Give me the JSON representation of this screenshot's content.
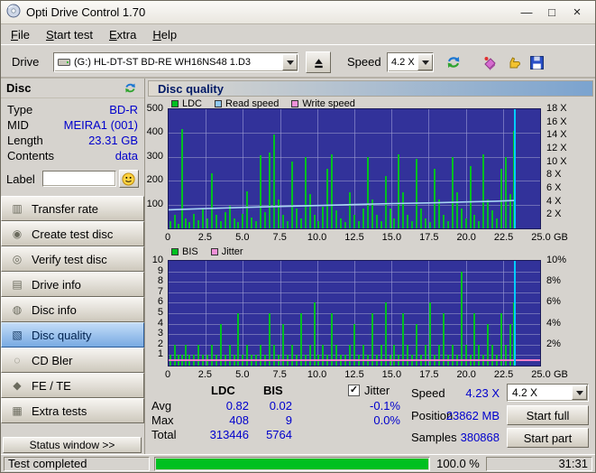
{
  "window": {
    "title": "Opti Drive Control 1.70",
    "controls": [
      {
        "name": "minimize",
        "glyph": "—"
      },
      {
        "name": "maximize",
        "glyph": "□"
      },
      {
        "name": "close",
        "glyph": "×"
      }
    ]
  },
  "menu": {
    "items": [
      "File",
      "Start test",
      "Extra",
      "Help"
    ]
  },
  "toolbar": {
    "drive_label": "Drive",
    "drive_value": "(G:)  HL-DT-ST BD-RE  WH16NS48 1.D3",
    "speed_label": "Speed",
    "speed_value": "4.2 X"
  },
  "sidebar": {
    "header": "Disc",
    "info": [
      {
        "label": "Type",
        "value": "BD-R"
      },
      {
        "label": "MID",
        "value": "MEIRA1 (001)"
      },
      {
        "label": "Length",
        "value": "23.31 GB"
      },
      {
        "label": "Contents",
        "value": "data"
      }
    ],
    "label_caption": "Label",
    "label_value": "",
    "buttons": [
      {
        "label": "Transfer rate",
        "glyph": "▥"
      },
      {
        "label": "Create test disc",
        "glyph": "◉"
      },
      {
        "label": "Verify test disc",
        "glyph": "◎"
      },
      {
        "label": "Drive info",
        "glyph": "▤"
      },
      {
        "label": "Disc info",
        "glyph": "◍"
      },
      {
        "label": "Disc quality",
        "glyph": "▧"
      },
      {
        "label": "CD Bler",
        "glyph": "◌"
      },
      {
        "label": "FE / TE",
        "glyph": "◆"
      },
      {
        "label": "Extra tests",
        "glyph": "▦"
      }
    ],
    "active_button": "Disc quality",
    "status_window_label": "Status window >>"
  },
  "main": {
    "panel_title": "Disc quality",
    "legend1": [
      {
        "label": "LDC",
        "color": "#00c020"
      },
      {
        "label": "Read speed",
        "color": "#90c8f0"
      },
      {
        "label": "Write speed",
        "color": "#f090d8"
      }
    ],
    "legend2": [
      {
        "label": "BIS",
        "color": "#00c020"
      },
      {
        "label": "Jitter",
        "color": "#f090d8"
      }
    ]
  },
  "stats": {
    "columns": [
      "LDC",
      "BIS"
    ],
    "rows": [
      {
        "label": "Avg",
        "ldc": "0.82",
        "bis": "0.02"
      },
      {
        "label": "Max",
        "ldc": "408",
        "bis": "9"
      },
      {
        "label": "Total",
        "ldc": "313446",
        "bis": "5764"
      }
    ],
    "jitter_label": "Jitter",
    "jitter_check_glyph": "✓",
    "jitter_values": [
      "-0.1%",
      "0.0%"
    ],
    "speed_label": "Speed",
    "speed_value": "4.23 X",
    "speed_select_value": "4.2 X",
    "position_label": "Position",
    "position_value": "23862 MB",
    "samples_label": "Samples",
    "samples_value": "380868",
    "start_full_label": "Start full",
    "start_part_label": "Start part"
  },
  "statusbar": {
    "status_text": "Test completed",
    "progress_percent": 100,
    "percent_label": "100.0 %",
    "elapsed": "31:31"
  },
  "chart_data": [
    {
      "id": "chart1",
      "type": "bar",
      "title": "LDC errors with read speed overlay",
      "x_max": 25.0,
      "x_unit": "GB",
      "x_ticks": [
        "0",
        "2.5",
        "5.0",
        "7.5",
        "10.0",
        "12.5",
        "15.0",
        "17.5",
        "20.0",
        "22.5",
        "25.0"
      ],
      "y_left": {
        "max": 500,
        "ticks": [
          "500",
          "400",
          "300",
          "200",
          "100"
        ]
      },
      "y_right": {
        "ticks": [
          "18 X",
          "16 X",
          "14 X",
          "12 X",
          "10 X",
          "8 X",
          "6 X",
          "4 X",
          "2 X"
        ]
      },
      "bar_color": "#00c020",
      "bars": [
        [
          0.15,
          30
        ],
        [
          0.4,
          55
        ],
        [
          0.65,
          20
        ],
        [
          0.9,
          415
        ],
        [
          1.15,
          40
        ],
        [
          1.4,
          25
        ],
        [
          1.7,
          60
        ],
        [
          2.0,
          35
        ],
        [
          2.3,
          85
        ],
        [
          2.6,
          40
        ],
        [
          2.9,
          230
        ],
        [
          3.2,
          55
        ],
        [
          3.5,
          30
        ],
        [
          3.8,
          70
        ],
        [
          4.1,
          95
        ],
        [
          4.4,
          40
        ],
        [
          4.7,
          25
        ],
        [
          5.0,
          60
        ],
        [
          5.3,
          155
        ],
        [
          5.6,
          45
        ],
        [
          5.9,
          30
        ],
        [
          6.2,
          305
        ],
        [
          6.5,
          70
        ],
        [
          6.8,
          320
        ],
        [
          7.1,
          395
        ],
        [
          7.4,
          120
        ],
        [
          7.7,
          55
        ],
        [
          8.0,
          30
        ],
        [
          8.3,
          280
        ],
        [
          8.6,
          85
        ],
        [
          8.9,
          40
        ],
        [
          9.2,
          300
        ],
        [
          9.5,
          145
        ],
        [
          9.8,
          55
        ],
        [
          10.1,
          30
        ],
        [
          10.4,
          90
        ],
        [
          10.7,
          250
        ],
        [
          11.0,
          310
        ],
        [
          11.3,
          75
        ],
        [
          11.6,
          40
        ],
        [
          11.9,
          25
        ],
        [
          12.2,
          150
        ],
        [
          12.5,
          55
        ],
        [
          12.8,
          30
        ],
        [
          13.1,
          85
        ],
        [
          13.4,
          300
        ],
        [
          13.7,
          120
        ],
        [
          14.0,
          55
        ],
        [
          14.3,
          30
        ],
        [
          14.6,
          220
        ],
        [
          14.9,
          85
        ],
        [
          15.2,
          40
        ],
        [
          15.5,
          310
        ],
        [
          15.8,
          150
        ],
        [
          16.1,
          55
        ],
        [
          16.4,
          30
        ],
        [
          16.7,
          290
        ],
        [
          17.0,
          85
        ],
        [
          17.3,
          40
        ],
        [
          17.6,
          25
        ],
        [
          17.9,
          250
        ],
        [
          18.2,
          120
        ],
        [
          18.5,
          55
        ],
        [
          18.8,
          30
        ],
        [
          19.1,
          300
        ],
        [
          19.4,
          150
        ],
        [
          19.7,
          85
        ],
        [
          20.0,
          40
        ],
        [
          20.3,
          260
        ],
        [
          20.6,
          55
        ],
        [
          20.9,
          30
        ],
        [
          21.2,
          310
        ],
        [
          21.5,
          120
        ],
        [
          21.8,
          75
        ],
        [
          22.1,
          40
        ],
        [
          22.4,
          250
        ],
        [
          22.7,
          300
        ],
        [
          23.0,
          145
        ],
        [
          23.25,
          408
        ]
      ],
      "line": {
        "name": "read-speed",
        "color": "#a8d4f4",
        "points": [
          [
            0,
            78
          ],
          [
            2.5,
            83
          ],
          [
            5,
            88
          ],
          [
            7.5,
            92
          ],
          [
            10,
            96
          ],
          [
            12.5,
            100
          ],
          [
            15,
            104
          ],
          [
            17.5,
            107
          ],
          [
            20,
            111
          ],
          [
            22,
            114
          ],
          [
            23.3,
            117
          ]
        ]
      },
      "end_marker_x": 23.32
    },
    {
      "id": "chart2",
      "type": "bar",
      "title": "BIS errors with jitter overlay",
      "x_max": 25.0,
      "x_unit": "GB",
      "x_ticks": [
        "0",
        "2.5",
        "5.0",
        "7.5",
        "10.0",
        "12.5",
        "15.0",
        "17.5",
        "20.0",
        "22.5",
        "25.0"
      ],
      "y_left": {
        "max": 10,
        "ticks": [
          "10",
          "9",
          "8",
          "7",
          "6",
          "5",
          "4",
          "3",
          "2",
          "1"
        ]
      },
      "y_right": {
        "ticks": [
          "10%",
          "8%",
          "6%",
          "4%",
          "2%"
        ]
      },
      "bar_color": "#00c020",
      "bars": [
        [
          0.15,
          1
        ],
        [
          0.4,
          2
        ],
        [
          0.65,
          1
        ],
        [
          0.9,
          1
        ],
        [
          1.15,
          2
        ],
        [
          1.4,
          1
        ],
        [
          1.7,
          1
        ],
        [
          2.0,
          2
        ],
        [
          2.3,
          1
        ],
        [
          2.6,
          1
        ],
        [
          2.9,
          2
        ],
        [
          3.2,
          1
        ],
        [
          3.5,
          4
        ],
        [
          3.8,
          1
        ],
        [
          4.1,
          2
        ],
        [
          4.4,
          1
        ],
        [
          4.7,
          5
        ],
        [
          5.0,
          1
        ],
        [
          5.3,
          2
        ],
        [
          5.6,
          1
        ],
        [
          5.9,
          1
        ],
        [
          6.2,
          2
        ],
        [
          6.5,
          1
        ],
        [
          6.8,
          5
        ],
        [
          7.1,
          2
        ],
        [
          7.4,
          1
        ],
        [
          7.7,
          4
        ],
        [
          8.0,
          1
        ],
        [
          8.3,
          2
        ],
        [
          8.6,
          1
        ],
        [
          8.9,
          5
        ],
        [
          9.2,
          1
        ],
        [
          9.5,
          2
        ],
        [
          9.8,
          6
        ],
        [
          10.1,
          1
        ],
        [
          10.4,
          2
        ],
        [
          10.7,
          1
        ],
        [
          11.0,
          5
        ],
        [
          11.3,
          2
        ],
        [
          11.6,
          1
        ],
        [
          11.9,
          1
        ],
        [
          12.2,
          2
        ],
        [
          12.5,
          4
        ],
        [
          12.8,
          1
        ],
        [
          13.1,
          2
        ],
        [
          13.4,
          1
        ],
        [
          13.7,
          5
        ],
        [
          14.0,
          1
        ],
        [
          14.3,
          2
        ],
        [
          14.6,
          6
        ],
        [
          14.9,
          1
        ],
        [
          15.2,
          2
        ],
        [
          15.5,
          1
        ],
        [
          15.8,
          5
        ],
        [
          16.1,
          2
        ],
        [
          16.4,
          1
        ],
        [
          16.7,
          4
        ],
        [
          17.0,
          1
        ],
        [
          17.3,
          2
        ],
        [
          17.6,
          6
        ],
        [
          17.9,
          1
        ],
        [
          18.2,
          2
        ],
        [
          18.5,
          5
        ],
        [
          18.8,
          1
        ],
        [
          19.1,
          2
        ],
        [
          19.4,
          1
        ],
        [
          19.7,
          9
        ],
        [
          20.0,
          2
        ],
        [
          20.3,
          1
        ],
        [
          20.6,
          5
        ],
        [
          20.9,
          2
        ],
        [
          21.2,
          1
        ],
        [
          21.5,
          4
        ],
        [
          21.8,
          2
        ],
        [
          22.1,
          1
        ],
        [
          22.4,
          5
        ],
        [
          22.7,
          2
        ],
        [
          23.0,
          4
        ],
        [
          23.25,
          6
        ]
      ],
      "jitter_line_value": 0.4,
      "jitter_color": "#f080c8",
      "end_marker_x": 23.32
    }
  ]
}
